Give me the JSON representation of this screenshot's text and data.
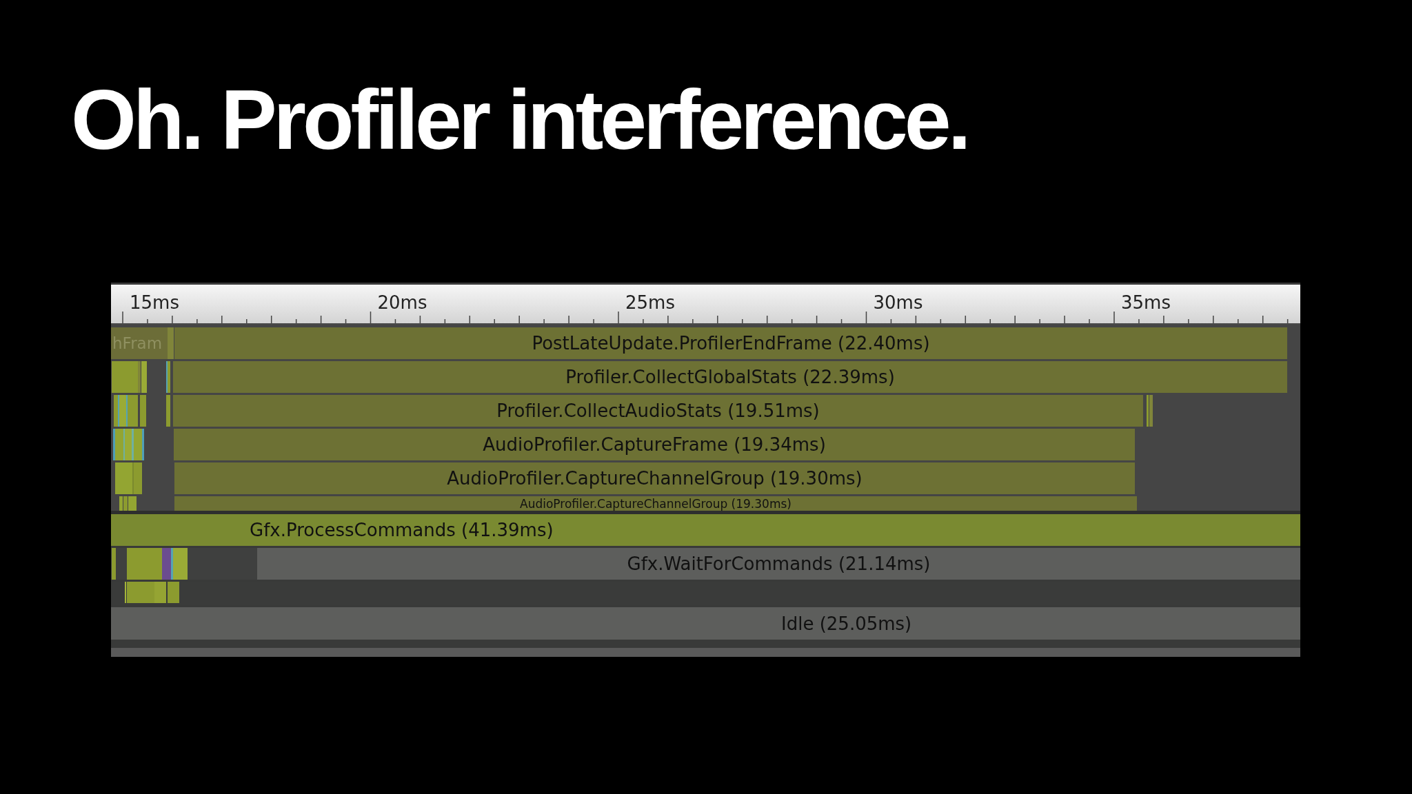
{
  "slide": {
    "title": "Oh. Profiler interference."
  },
  "profiler": {
    "ruler": {
      "ticks": [
        "15ms",
        "20ms",
        "25ms",
        "30ms",
        "35ms"
      ]
    },
    "rows_upper": [
      {
        "bars": [
          {
            "label": "hFram",
            "kind": "faded"
          },
          {
            "label": "PostLateUpdate.ProfilerEndFrame (22.40ms)",
            "kind": "sample"
          }
        ]
      },
      {
        "bars": [
          {
            "label": "Profiler.CollectGlobalStats (22.39ms)",
            "kind": "sample"
          }
        ]
      },
      {
        "bars": [
          {
            "label": "Profiler.CollectAudioStats (19.51ms)",
            "kind": "sample"
          }
        ]
      },
      {
        "bars": [
          {
            "label": "AudioProfiler.CaptureFrame (19.34ms)",
            "kind": "sample"
          }
        ]
      },
      {
        "bars": [
          {
            "label": "AudioProfiler.CaptureChannelGroup (19.30ms)",
            "kind": "sample"
          }
        ]
      },
      {
        "bars": [
          {
            "label": "AudioProfiler.CaptureChannelGroup (19.30ms)",
            "kind": "sample"
          }
        ]
      }
    ],
    "rows_lower": [
      {
        "bars": [
          {
            "label": "Gfx.ProcessCommands (41.39ms)",
            "kind": "render"
          }
        ]
      },
      {
        "bars": [
          {
            "label": "Gfx.WaitForCommands (21.14ms)",
            "kind": "wait"
          }
        ]
      },
      {
        "bars": [
          {
            "label": "Idle (25.05ms)",
            "kind": "wait"
          }
        ]
      }
    ]
  }
}
